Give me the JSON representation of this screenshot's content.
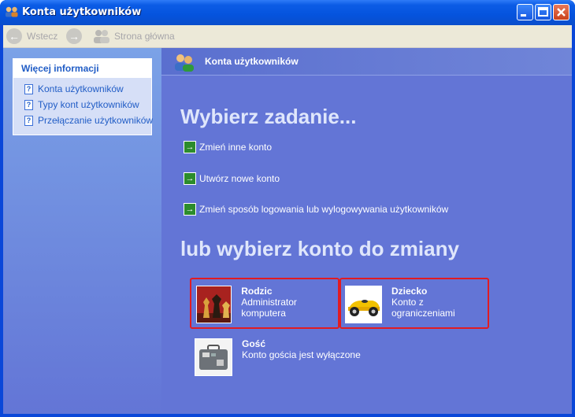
{
  "window": {
    "title": "Konta użytkowników",
    "app_icon": "users-app-icon"
  },
  "titlebar_buttons": {
    "minimize": "minimize-icon",
    "maximize": "maximize-icon",
    "close": "close-icon"
  },
  "toolbar": {
    "back_label": "Wstecz",
    "home_label": "Strona główna"
  },
  "sidebar": {
    "panel_title": "Więcej informacji",
    "links": [
      "Konta użytkowników",
      "Typy kont użytkowników",
      "Przełączanie użytkowników"
    ]
  },
  "main": {
    "header_title": "Konta użytkowników",
    "pick_task_heading": "Wybierz zadanie...",
    "tasks": [
      "Zmień inne konto",
      "Utwórz nowe konto",
      "Zmień sposób logowania lub wylogowywania użytkowników"
    ],
    "pick_account_heading": "lub wybierz konto do zmiany",
    "accounts": [
      {
        "name": "Rodzic",
        "type": "Administrator komputera",
        "picture": "chess-pieces"
      },
      {
        "name": "Dziecko",
        "type": "Konto z ograniczeniami",
        "picture": "yellow-toy-car"
      },
      {
        "name": "Gość",
        "type": "Konto gościa jest wyłączone",
        "picture": "suitcase"
      }
    ]
  },
  "colors": {
    "titlebar": "#0553dd",
    "sidebar_top": "#7ba2e7",
    "content_bg": "#6375d6",
    "highlight": "#e11b22",
    "task_arrow": "#2c8c2c"
  }
}
